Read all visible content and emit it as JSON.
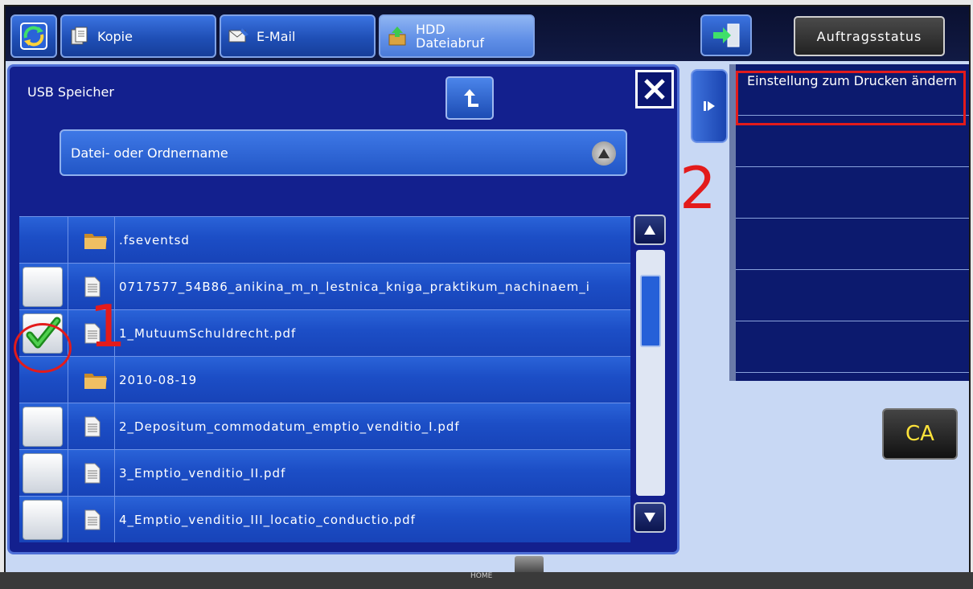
{
  "topbar": {
    "tabs": [
      {
        "label": "Kopie",
        "icon": "copy-icon"
      },
      {
        "label": "E-Mail",
        "icon": "email-icon"
      },
      {
        "label_line1": "HDD",
        "label_line2": "Dateiabruf",
        "icon": "folder-upload-icon",
        "active": true
      }
    ],
    "home_icon": "home-rotate-icon",
    "exit_icon": "exit-door-icon",
    "status_label": "Auftragsstatus"
  },
  "browser": {
    "location_label": "USB Speicher",
    "sort_label": "Datei- oder Ordnername",
    "files": [
      {
        "name": ".fseventsd",
        "type": "folder",
        "checked": false
      },
      {
        "name": "0717577_54B86_anikina_m_n_lestnica_kniga_praktikum_nachinaem_i",
        "type": "file",
        "checked": false
      },
      {
        "name": "1_MutuumSchuldrecht.pdf",
        "type": "file",
        "checked": true
      },
      {
        "name": "2010-08-19",
        "type": "folder",
        "checked": false
      },
      {
        "name": "2_Depositum_commodatum_emptio_venditio_I.pdf",
        "type": "file",
        "checked": false
      },
      {
        "name": "3_Emptio_venditio_II.pdf",
        "type": "file",
        "checked": false
      },
      {
        "name": "4_Emptio_venditio_III_locatio_conductio.pdf",
        "type": "file",
        "checked": false
      }
    ],
    "scroll_position": 0.1
  },
  "sidepanel": {
    "items": [
      {
        "label": "Einstellung zum Drucken ändern"
      },
      {
        "label": ""
      },
      {
        "label": ""
      },
      {
        "label": ""
      },
      {
        "label": ""
      },
      {
        "label": ""
      }
    ]
  },
  "ca_label": "CA",
  "bottom": {
    "home_label": "HOME"
  },
  "annotations": {
    "step1": "1",
    "step2": "2",
    "color": "#e31b1b"
  }
}
